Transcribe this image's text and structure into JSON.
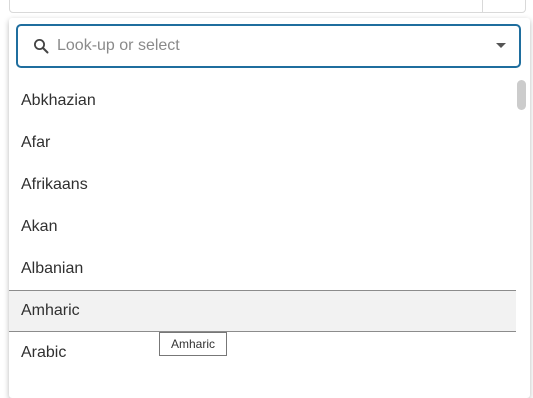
{
  "search": {
    "placeholder": "Look-up or select",
    "value": ""
  },
  "options": [
    {
      "label": "Abkhazian"
    },
    {
      "label": "Afar"
    },
    {
      "label": "Afrikaans"
    },
    {
      "label": "Akan"
    },
    {
      "label": "Albanian"
    },
    {
      "label": "Amharic",
      "highlighted": true
    },
    {
      "label": "Arabic"
    }
  ],
  "tooltip": {
    "text": "Amharic"
  },
  "icons": {
    "search": "search-icon",
    "dropdown": "chevron-down-icon"
  },
  "colors": {
    "focus_border": "#1f6e9e",
    "highlight_bg": "#f2f2f2"
  }
}
